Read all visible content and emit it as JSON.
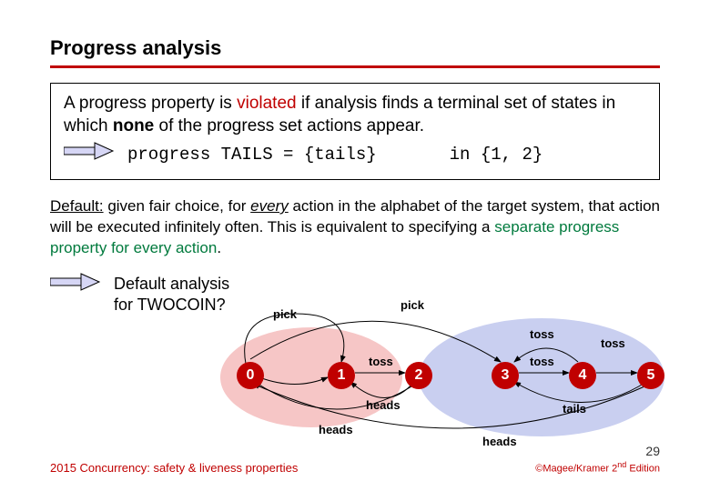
{
  "title": "Progress analysis",
  "box": {
    "p1_a": "A progress property is ",
    "p1_violated": "violated",
    "p1_b": " if analysis finds a terminal set of states in which ",
    "p1_none": "none",
    "p1_c": " of the progress set actions appear.",
    "code_left": "progress TAILS = {tails}",
    "code_right": "in {1, 2}"
  },
  "default_para": {
    "a": "Default:",
    "b": " given fair choice, for ",
    "c": "every",
    "d": " action in the alphabet of the target system, that action will be executed infinitely often. This is equivalent to specifying a ",
    "e": "separate progress property for every action",
    "f": "."
  },
  "analysis": {
    "line1": "Default analysis",
    "line2": "for TWOCOIN?"
  },
  "diagram": {
    "labels": {
      "pick1": "pick",
      "pick2": "pick",
      "toss1": "toss",
      "toss2": "toss",
      "toss3": "toss",
      "toss4": "toss",
      "heads1": "heads",
      "heads2": "heads",
      "heads3": "heads",
      "tails": "tails"
    },
    "states": [
      "0",
      "1",
      "2",
      "3",
      "4",
      "5"
    ]
  },
  "footer": {
    "left": "2015  Concurrency: safety & liveness properties",
    "right_a": "©Magee/Kramer ",
    "right_b": "2",
    "right_c": "nd",
    "right_d": " Edition"
  },
  "slideno": "29"
}
